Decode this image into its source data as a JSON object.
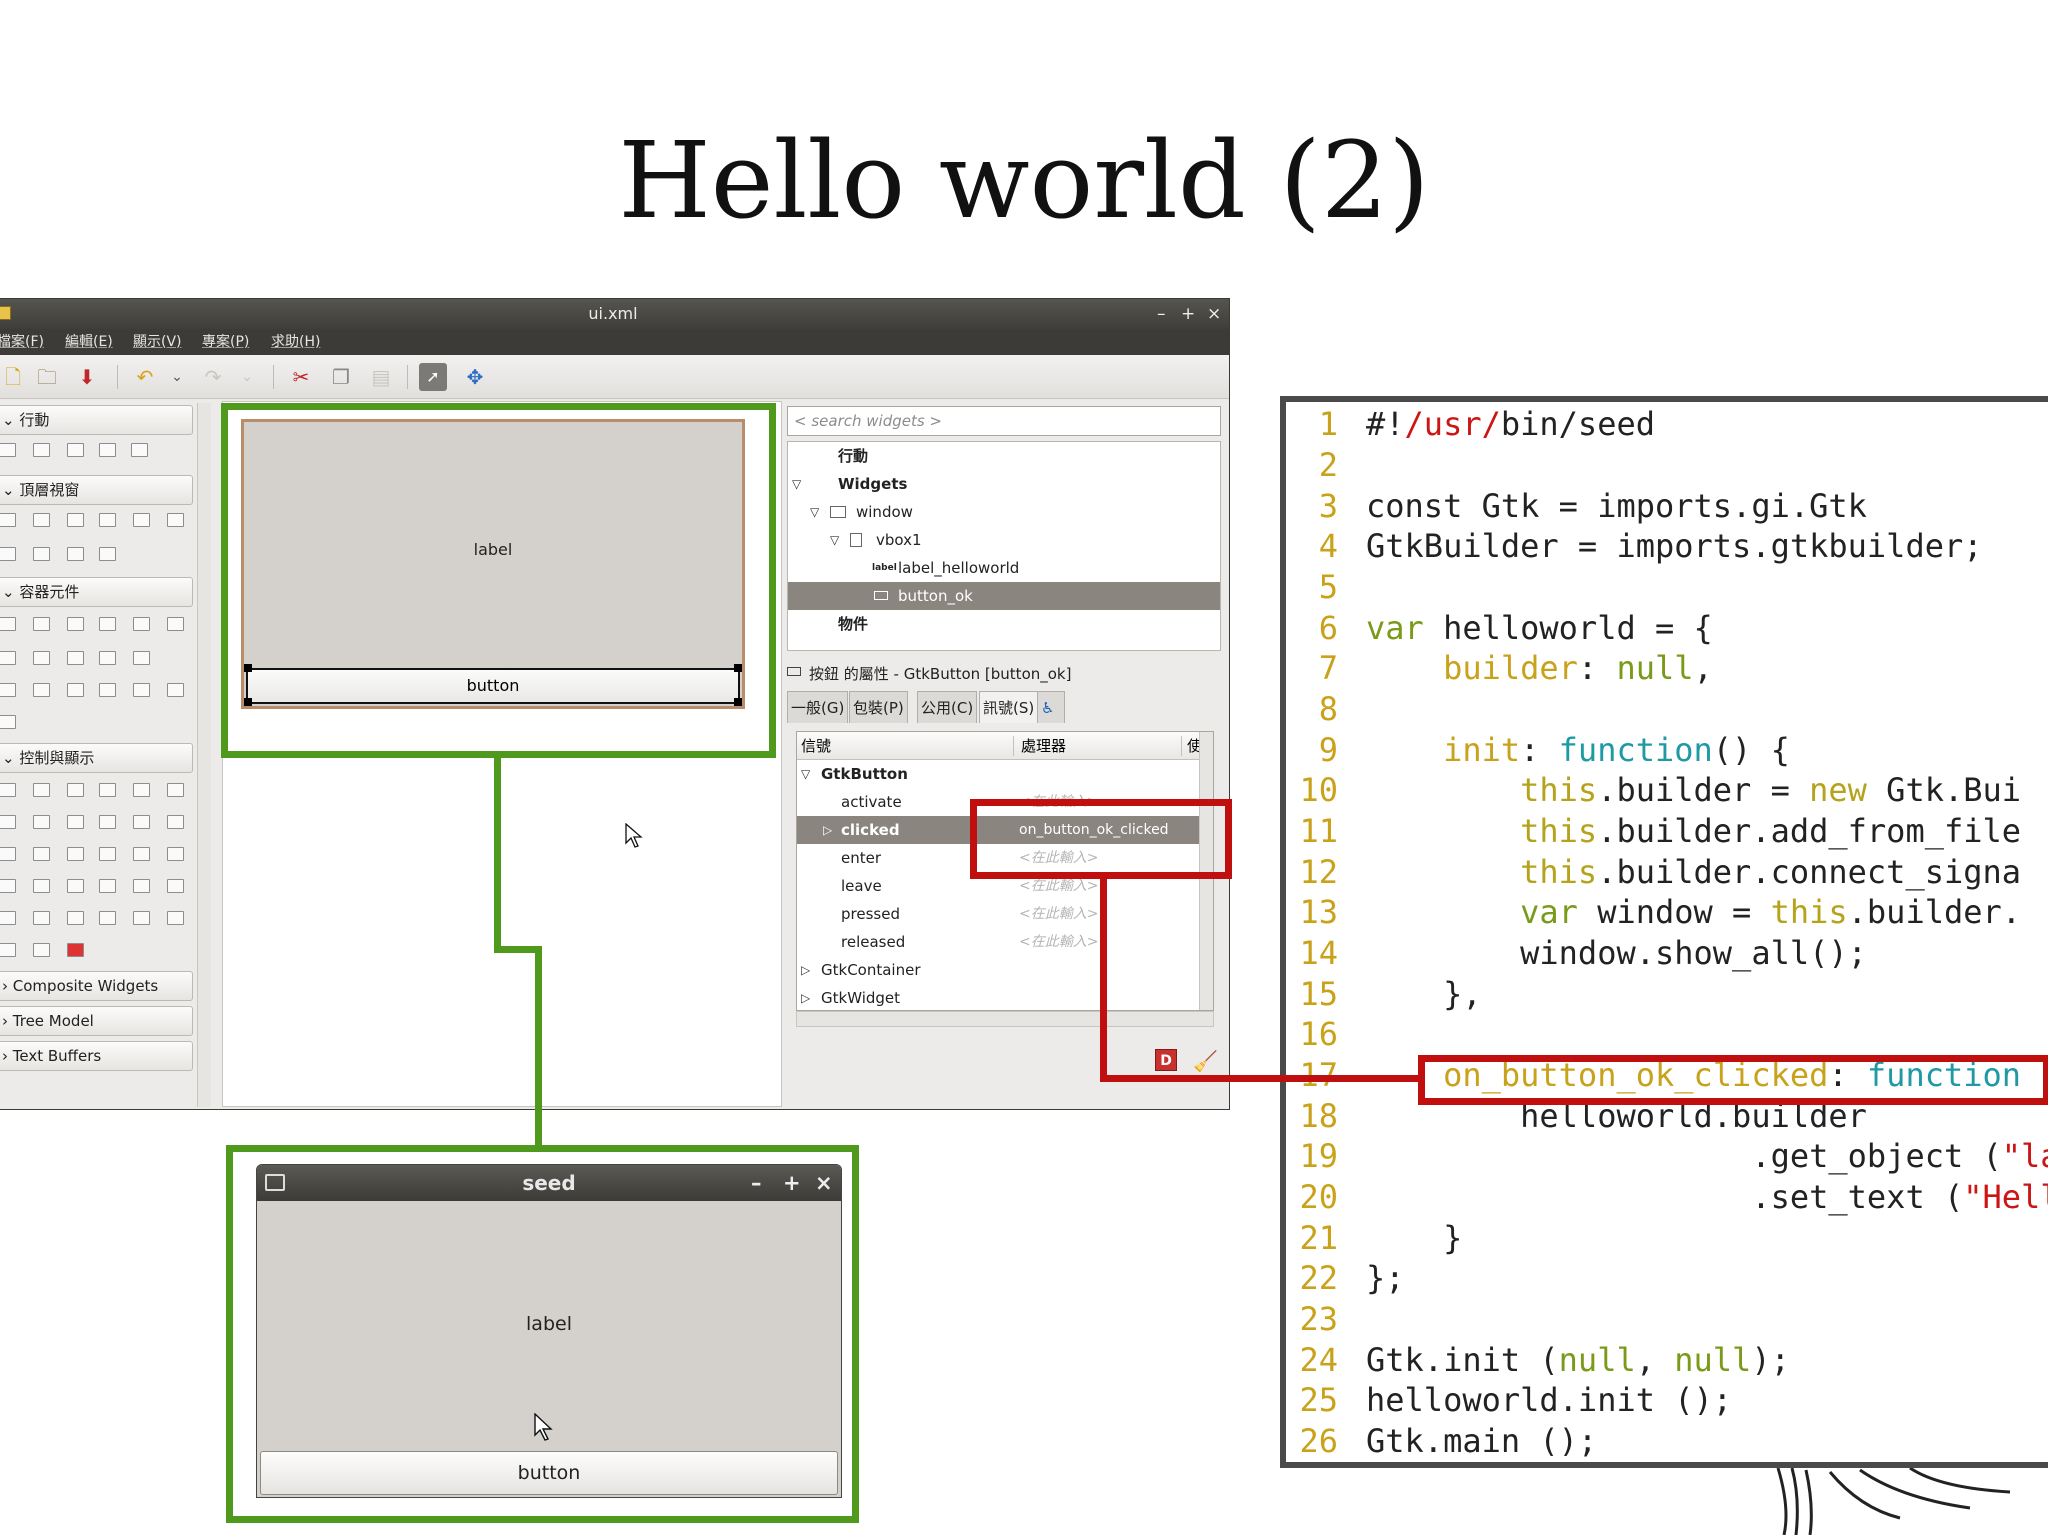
{
  "slide": {
    "title": "Hello world (2)"
  },
  "glade": {
    "window_title": "ui.xml",
    "window_controls": [
      "–",
      "+",
      "×"
    ],
    "menu": [
      "檔案(F)",
      "編輯(E)",
      "顯示(V)",
      "專案(P)",
      "求助(H)"
    ],
    "palette": {
      "groups": [
        "行動",
        "頂層視窗",
        "容器元件",
        "控制與顯示",
        "Composite Widgets",
        "Tree Model",
        "Text Buffers"
      ]
    },
    "design": {
      "label": "label",
      "button": "button"
    },
    "search_placeholder": "< search widgets >",
    "tree": {
      "rows": [
        "行動",
        "Widgets",
        "window",
        "vbox1",
        "label_helloworld",
        "button_ok",
        "物件"
      ]
    },
    "properties_title": "按鈕 的屬性 - GtkButton [button_ok]",
    "tabs": [
      "一般(G)",
      "包裝(P)",
      "公用(C)",
      "訊號(S)"
    ],
    "signals": {
      "headers": [
        "信號",
        "處理器",
        "使"
      ],
      "groups": [
        "GtkButton",
        "GtkContainer",
        "GtkWidget"
      ],
      "rows": [
        {
          "name": "activate",
          "handler": "<在此輸入>"
        },
        {
          "name": "clicked",
          "handler": "on_button_ok_clicked"
        },
        {
          "name": "enter",
          "handler": "<在此輸入>"
        },
        {
          "name": "leave",
          "handler": "<在此輸入>"
        },
        {
          "name": "pressed",
          "handler": "<在此輸入>"
        },
        {
          "name": "released",
          "handler": "<在此輸入>"
        }
      ]
    }
  },
  "seed_window": {
    "title": "seed",
    "label": "label",
    "button": "button"
  },
  "code": {
    "line_numbers": [
      "1",
      "2",
      "3",
      "4",
      "5",
      "6",
      "7",
      "8",
      "9",
      "10",
      "11",
      "12",
      "13",
      "14",
      "15",
      "16",
      "17",
      "18",
      "19",
      "20",
      "21",
      "22",
      "23",
      "24",
      "25",
      "26"
    ],
    "t": {
      "l1a": "#!",
      "l1b": "/usr/",
      "l1c": "bin/seed",
      "l3": "const Gtk = imports.gi.Gtk",
      "l4": "GtkBuilder = imports.gtkbuilder;",
      "l6a": "var",
      "l6b": " helloworld = {",
      "l7a": "    builder",
      "l7b": ": ",
      "l7c": "null",
      "l7d": ",",
      "l9a": "    init",
      "l9b": ": ",
      "l9c": "function",
      "l9d": "() {",
      "l10a": "        this",
      "l10b": ".builder = ",
      "l10c": "new",
      "l10d": " Gtk.Bui",
      "l11a": "        this",
      "l11b": ".builder.add_from_file",
      "l12a": "        this",
      "l12b": ".builder.connect_signa",
      "l13a": "        var",
      "l13b": " window = ",
      "l13c": "this",
      "l13d": ".builder.",
      "l14": "        window.show_all();",
      "l15": "    },",
      "l17a": "    on_button_ok_clicked",
      "l17b": ": ",
      "l17c": "function",
      "l18": "        helloworld.builder",
      "l19a": "                    .get_object (",
      "l19b": "\"la",
      "l20a": "                    .set_text (",
      "l20b": "\"Hell",
      "l21": "    }",
      "l22": "};",
      "l24a": "Gtk.init (",
      "l24b": "null",
      "l24c": ", ",
      "l24d": "null",
      "l24e": ");",
      "l25": "helloworld.init ();",
      "l26": "Gtk.main ();"
    }
  },
  "colors": {
    "highlight_green": "#4f9a1d",
    "highlight_red": "#c00f0f"
  }
}
